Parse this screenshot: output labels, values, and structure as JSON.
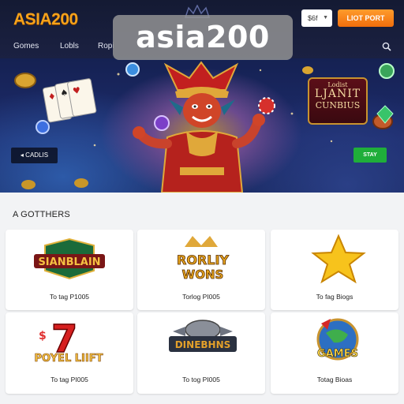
{
  "header": {
    "logo": "ASIA200",
    "watermark": "asia200",
    "language_select": "$6f",
    "login_button": "LIOT PORT",
    "nav": [
      "Gomes",
      "Lobls",
      "Ropi"
    ]
  },
  "hero": {
    "left_button": "CADLIS",
    "right_button": "STAY",
    "promo_sign": [
      "Lodist",
      "LJANIT",
      "CUNBIUS"
    ]
  },
  "games": {
    "section_title": "A GOTTHERS",
    "cards": [
      {
        "title_art": "SIANBLAIN",
        "caption": "To tag P1005"
      },
      {
        "title_art": "RORLIY WONS",
        "caption": "Torlog PI005"
      },
      {
        "title_art": "star",
        "caption": "To fag Biogs"
      },
      {
        "title_art": "POYEL LIIFT",
        "caption": "To tag PI005"
      },
      {
        "title_art": "DINEBHNS",
        "caption": "To tog PI005"
      },
      {
        "title_art": "GAMES",
        "caption": "Totag Bioas"
      }
    ]
  },
  "colors": {
    "header_bg": "#141a33",
    "logo": "#f6a21a",
    "login_orange": "#f47a14",
    "stay_green": "#1fae3a",
    "section_bg": "#f2f3f5"
  },
  "icons": [
    "crown-icon",
    "search-icon",
    "chevron-down-icon",
    "star-icon"
  ]
}
